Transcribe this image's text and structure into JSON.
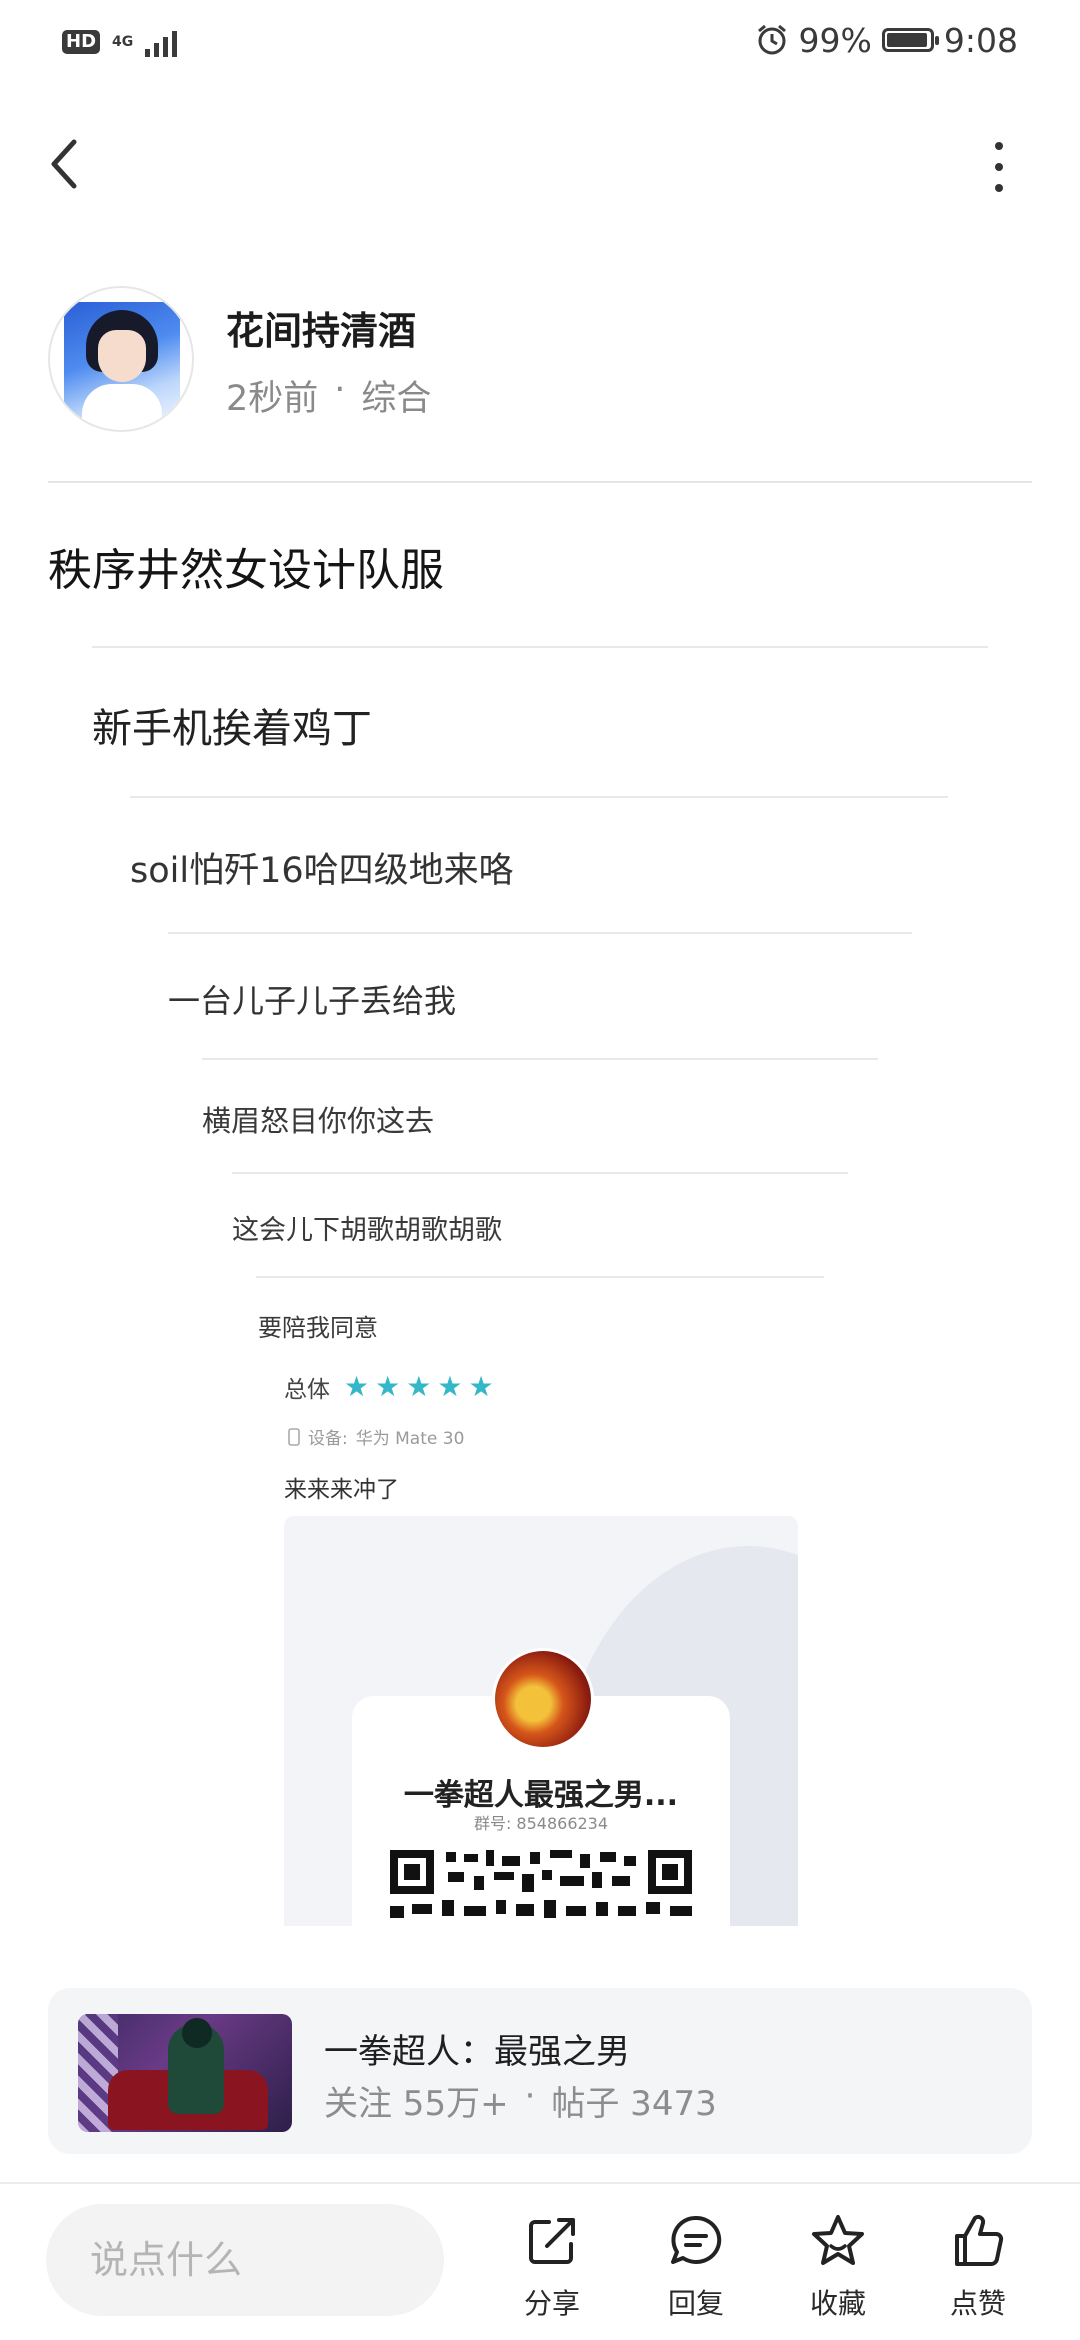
{
  "status_bar": {
    "hd_label": "HD",
    "network_label": "4G",
    "battery_percent": "99%",
    "battery_level": 0.99,
    "time": "9:08",
    "alarm_icon": "alarm-icon"
  },
  "header": {
    "back_icon": "chevron-left-icon",
    "more_icon": "more-vertical-icon"
  },
  "author": {
    "name": "花间持清酒",
    "time_ago": "2秒前",
    "separator": "·",
    "category": "综合"
  },
  "post": {
    "title": "秩序井然女设计队服",
    "nested_replies": [
      "新手机挨着鸡丁",
      "soil怕歼16哈四级地来咯",
      "一台儿子儿子丢给我",
      "横眉怒目你你这去",
      "这会儿下胡歌胡歌胡歌",
      "要陪我同意"
    ],
    "rating": {
      "label": "总体",
      "stars": 5,
      "star_color": "#33b7c9",
      "device_prefix": "设备:",
      "device_name": "华为 Mate 30"
    },
    "review_text": "来来来冲了",
    "qr_card": {
      "group_name": "一拳超人最强之男...",
      "group_id_label": "群号: 854866234"
    }
  },
  "forum": {
    "name": "一拳超人：最强之男",
    "followers": "关注 55万+",
    "separator": "·",
    "posts": "帖子 3473"
  },
  "bottom_bar": {
    "comment_placeholder": "说点什么",
    "actions": [
      {
        "label": "分享",
        "icon": "share-icon"
      },
      {
        "label": "回复",
        "icon": "reply-icon"
      },
      {
        "label": "收藏",
        "icon": "star-icon"
      },
      {
        "label": "点赞",
        "icon": "like-icon"
      }
    ]
  }
}
